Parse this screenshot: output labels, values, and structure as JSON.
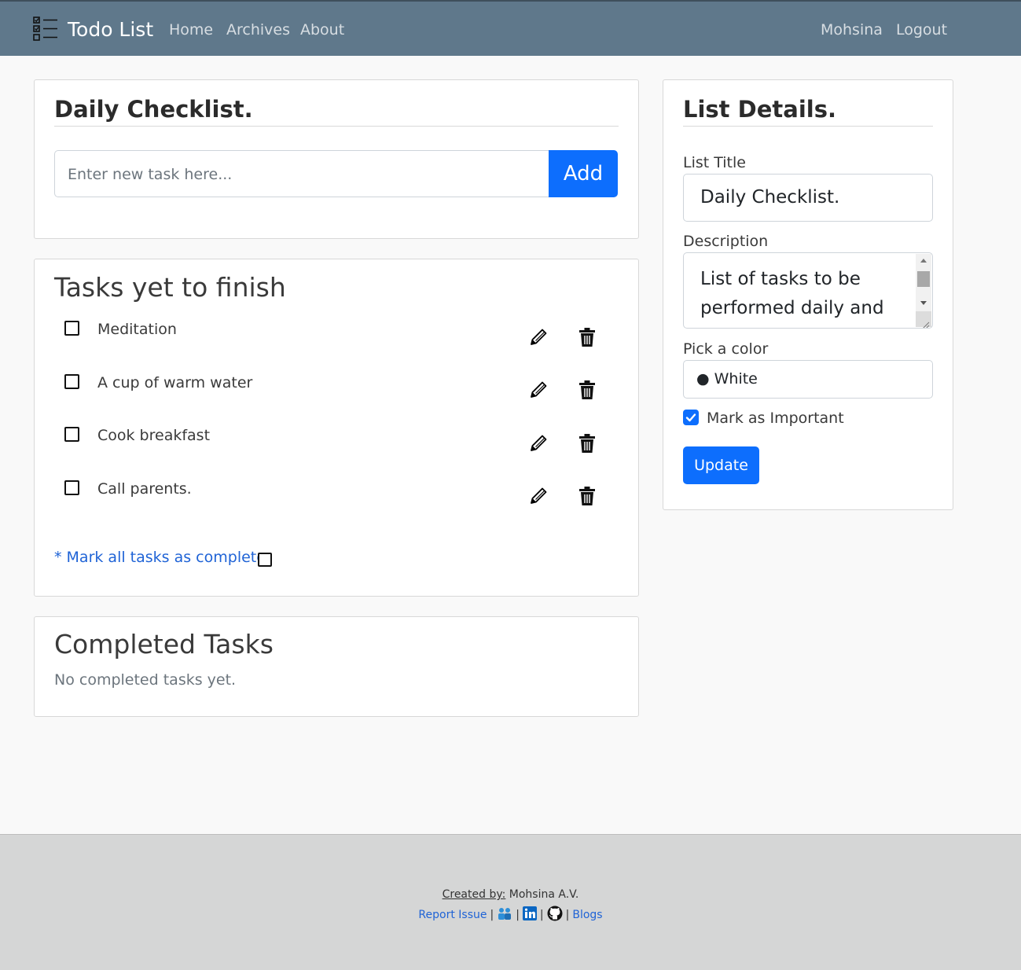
{
  "nav": {
    "brand": "Todo List",
    "links": [
      "Home",
      "Archives",
      "About"
    ],
    "user": "Mohsina",
    "logout": "Logout"
  },
  "checklist_card": {
    "title": "Daily Checklist.",
    "input_placeholder": "Enter new task here...",
    "add_label": "Add"
  },
  "pending": {
    "heading": "Tasks yet to finish",
    "tasks": [
      {
        "label": "Meditation"
      },
      {
        "label": "A cup of warm water"
      },
      {
        "label": "Cook breakfast"
      },
      {
        "label": "Call parents."
      }
    ],
    "mark_all": "* Mark all tasks as complete."
  },
  "completed": {
    "heading": "Completed Tasks",
    "empty_text": "No completed tasks yet."
  },
  "details": {
    "title": "List Details.",
    "title_label": "List Title",
    "title_value": "Daily Checklist.",
    "description_label": "Description",
    "description_value": "List of tasks to be performed daily and",
    "color_label": "Pick a color",
    "color_value": "● White",
    "important_label": "Mark as Important",
    "important_checked": true,
    "update_label": "Update"
  },
  "footer": {
    "created_by_label": "Created by:",
    "author": " Mohsina A.V.",
    "report_issue": "Report Issue",
    "sep": "|",
    "blogs": "Blogs"
  },
  "colors": {
    "navbar": "#5f788b",
    "primary": "#0d6efd",
    "link": "#1f63d6",
    "footer": "#d5d6d6"
  }
}
